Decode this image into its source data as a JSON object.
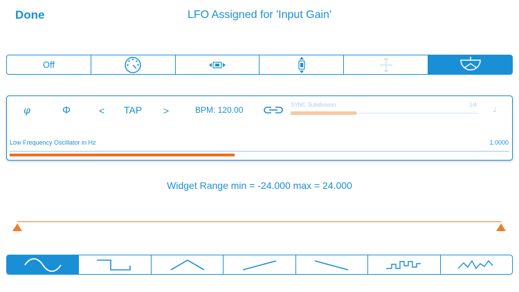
{
  "header": {
    "done_label": "Done",
    "title": "LFO Assigned for 'Input Gain'"
  },
  "modes": {
    "items": [
      {
        "label": "Off",
        "icon": ""
      },
      {
        "label": "",
        "icon": "dial-icon"
      },
      {
        "label": "",
        "icon": "horizontal-move-icon"
      },
      {
        "label": "",
        "icon": "vertical-move-icon"
      },
      {
        "label": "",
        "icon": "vertical-arrows-icon"
      },
      {
        "label": "",
        "icon": "half-dial-icon"
      }
    ],
    "active_index": 5
  },
  "lfo": {
    "phase_symbol": "φ",
    "phase_reset_symbol": "Φ",
    "prev": "<",
    "tap": "TAP",
    "next": ">",
    "bpm": "BPM: 120.00",
    "sync_label": "SYNC Subdivision",
    "sync_value": "1/4",
    "sync_level": 0.35,
    "freq_label": "Low Frequency Oscillator in Hz",
    "freq_value": "1.0000",
    "freq_level": 0.45
  },
  "range": {
    "text": "Widget Range min = -24.000 max = 24.000"
  },
  "waveforms": {
    "items": [
      "sine-wave-icon",
      "square-wave-icon",
      "triangle-wave-icon",
      "ramp-up-icon",
      "ramp-down-icon",
      "random-step-icon",
      "random-smooth-icon"
    ],
    "active_index": 0
  },
  "colors": {
    "accent": "#1a8fd6",
    "orange": "#ef6e1c",
    "sync_fill": "#f6c9a2",
    "muted": "#a9cde8"
  }
}
